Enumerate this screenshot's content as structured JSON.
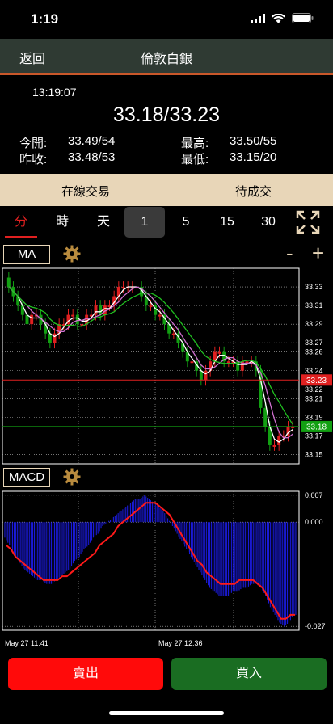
{
  "status_bar": {
    "time": "1:19"
  },
  "nav": {
    "back_label": "返回",
    "title": "倫敦白銀"
  },
  "quote": {
    "time": "13:19:07",
    "price": "33.18/33.23",
    "open_label": "今開:",
    "open_value": "33.49/54",
    "high_label": "最高:",
    "high_value": "33.50/55",
    "prev_close_label": "昨收:",
    "prev_close_value": "33.48/53",
    "low_label": "最低:",
    "low_value": "33.15/20"
  },
  "actions": {
    "online_trade": "在線交易",
    "pending": "待成交"
  },
  "timeframes": [
    "分",
    "時",
    "天",
    "1",
    "5",
    "15",
    "30"
  ],
  "indicators": {
    "main": "MA",
    "sub": "MACD",
    "minus": "-",
    "plus": "+"
  },
  "colors": {
    "up": "#e02020",
    "down": "#12a012",
    "ma_fast": "#ffffff",
    "ma_mid": "#d070d0",
    "ma_slow": "#20c020",
    "macd_bar": "#1a1ad8",
    "macd_line": "#ff1a1a",
    "ask_line": "#e02020",
    "bid_line": "#12a012"
  },
  "chart_data": [
    {
      "type": "candlestick",
      "yticks": [
        "33.33",
        "33.31",
        "33.29",
        "33.27",
        "33.26",
        "33.24",
        "33.22",
        "33.21",
        "33.19",
        "33.17",
        "33.15"
      ],
      "ylim": [
        33.14,
        33.35
      ],
      "ask_marker": "33.23",
      "bid_marker": "33.18",
      "xlabels": [
        "May 27 11:41",
        "May 27 12:36"
      ],
      "close": [
        33.33,
        33.32,
        33.31,
        33.3,
        33.29,
        33.3,
        33.3,
        33.29,
        33.28,
        33.27,
        33.28,
        33.29,
        33.29,
        33.3,
        33.3,
        33.29,
        33.29,
        33.3,
        33.3,
        33.31,
        33.3,
        33.31,
        33.31,
        33.32,
        33.33,
        33.33,
        33.33,
        33.33,
        33.33,
        33.32,
        33.31,
        33.31,
        33.3,
        33.3,
        33.29,
        33.28,
        33.28,
        33.27,
        33.26,
        33.25,
        33.25,
        33.24,
        33.23,
        33.24,
        33.25,
        33.26,
        33.26,
        33.25,
        33.25,
        33.25,
        33.24,
        33.25,
        33.25,
        33.25,
        33.24,
        33.2,
        33.18,
        33.16,
        33.16,
        33.17,
        33.17,
        33.18,
        33.18
      ]
    },
    {
      "type": "bar+line",
      "yticks": [
        "0.007",
        "0.000",
        "-0.027"
      ],
      "ylim": [
        -0.028,
        0.008
      ],
      "histogram": [
        -0.004,
        -0.006,
        -0.008,
        -0.01,
        -0.012,
        -0.013,
        -0.014,
        -0.015,
        -0.015,
        -0.016,
        -0.016,
        -0.015,
        -0.014,
        -0.013,
        -0.012,
        -0.01,
        -0.009,
        -0.007,
        -0.006,
        -0.004,
        -0.003,
        -0.001,
        0.0,
        0.001,
        0.002,
        0.003,
        0.004,
        0.005,
        0.006,
        0.006,
        0.007,
        0.006,
        0.005,
        0.004,
        0.003,
        0.001,
        -0.001,
        -0.003,
        -0.005,
        -0.007,
        -0.009,
        -0.011,
        -0.013,
        -0.015,
        -0.017,
        -0.018,
        -0.019,
        -0.019,
        -0.019,
        -0.018,
        -0.018,
        -0.017,
        -0.017,
        -0.016,
        -0.016,
        -0.017,
        -0.019,
        -0.022,
        -0.024,
        -0.026,
        -0.027,
        -0.026,
        -0.024
      ],
      "signal": [
        -0.006,
        -0.007,
        -0.009,
        -0.01,
        -0.011,
        -0.012,
        -0.013,
        -0.014,
        -0.015,
        -0.015,
        -0.015,
        -0.015,
        -0.014,
        -0.014,
        -0.013,
        -0.012,
        -0.011,
        -0.01,
        -0.009,
        -0.008,
        -0.006,
        -0.005,
        -0.004,
        -0.003,
        -0.001,
        0.0,
        0.001,
        0.002,
        0.003,
        0.004,
        0.005,
        0.005,
        0.005,
        0.004,
        0.003,
        0.002,
        0.0,
        -0.002,
        -0.004,
        -0.006,
        -0.008,
        -0.01,
        -0.011,
        -0.013,
        -0.014,
        -0.015,
        -0.016,
        -0.016,
        -0.016,
        -0.016,
        -0.015,
        -0.015,
        -0.015,
        -0.015,
        -0.016,
        -0.017,
        -0.019,
        -0.021,
        -0.023,
        -0.025,
        -0.025,
        -0.024,
        -0.024
      ]
    }
  ],
  "buttons": {
    "sell": "賣出",
    "buy": "買入"
  }
}
